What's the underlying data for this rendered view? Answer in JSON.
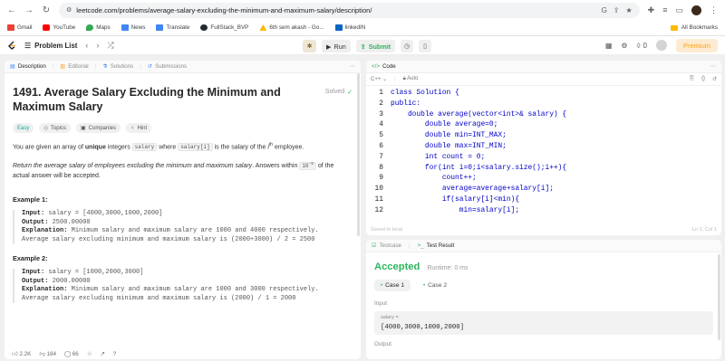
{
  "browser": {
    "url": "leetcode.com/problems/average-salary-excluding-the-minimum-and-maximum-salary/description/",
    "bookmarks": [
      "Gmail",
      "YouTube",
      "Maps",
      "News",
      "Translate",
      "FullStack_BVP",
      "6th sem akash - Go...",
      "linkedIN"
    ],
    "all_bookmarks": "All Bookmarks"
  },
  "topbar": {
    "problem_list": "Problem List",
    "run": "Run",
    "submit": "Submit",
    "streak": "0",
    "premium": "Premium"
  },
  "left": {
    "tabs": [
      "Description",
      "Editorial",
      "Solutions",
      "Submissions"
    ],
    "title": "1491. Average Salary Excluding the Minimum and Maximum Salary",
    "solved": "Solved",
    "chips": [
      "Easy",
      "Topics",
      "Companies",
      "Hint"
    ],
    "p1_before": "You are given an array of ",
    "p1_bold": "unique",
    "p1_mid": " integers ",
    "p1_code1": "salary",
    "p1_mid2": " where ",
    "p1_code2": "salary[i]",
    "p1_mid3": " is the salary of the ",
    "p1_sup": "th",
    "p1_end": " employee.",
    "p2_italic": "Return the average salary of employees excluding the minimum and maximum salary",
    "p2_mid": ". Answers within ",
    "p2_code": "10",
    "p2_sup": "-5",
    "p2_end": " of the actual answer will be accepted.",
    "example1_title": "Example 1:",
    "example1": {
      "input": "salary = [4000,3000,1000,2000]",
      "output": "2500.00000",
      "explanation1": "Minimum salary and maximum salary are 1000 and 4000 respectively.",
      "explanation2": "Average salary excluding minimum and maximum salary is (2000+3000) / 2 = 2500"
    },
    "example2_title": "Example 2:",
    "example2": {
      "input": "salary = [1000,2000,3000]",
      "output": "2000.00000",
      "explanation1": "Minimum salary and maximum salary are 1000 and 3000 respectively.",
      "explanation2": "Average salary excluding minimum and maximum salary is (2000) / 1 = 2000"
    },
    "labels": {
      "input": "Input:",
      "output": "Output:",
      "explanation": "Explanation:"
    },
    "footer": {
      "likes": "2.2K",
      "dislikes": "184",
      "comments": "66"
    }
  },
  "code": {
    "tab": "Code",
    "language": "C++",
    "mode": "Auto",
    "lines": [
      "class Solution {",
      "public:",
      "    double average(vector<int>& salary) {",
      "        double average=0;",
      "        double min=INT_MAX;",
      "        double max=INT_MIN;",
      "        int count = 0;",
      "        for(int i=0;i<salary.size();i++){",
      "            count++;",
      "            average=average+salary[i];",
      "            if(salary[i]<min){",
      "                min=salary[i];"
    ],
    "saved": "Saved to local",
    "cursor": "Ln 1, Col 1"
  },
  "result": {
    "tabs": [
      "Testcase",
      "Test Result"
    ],
    "status": "Accepted",
    "runtime": "Runtime: 0 ms",
    "cases": [
      "Case 1",
      "Case 2"
    ],
    "input_label": "Input",
    "var": "salary =",
    "value": "[4000,3000,1000,2000]",
    "output_label": "Output"
  }
}
